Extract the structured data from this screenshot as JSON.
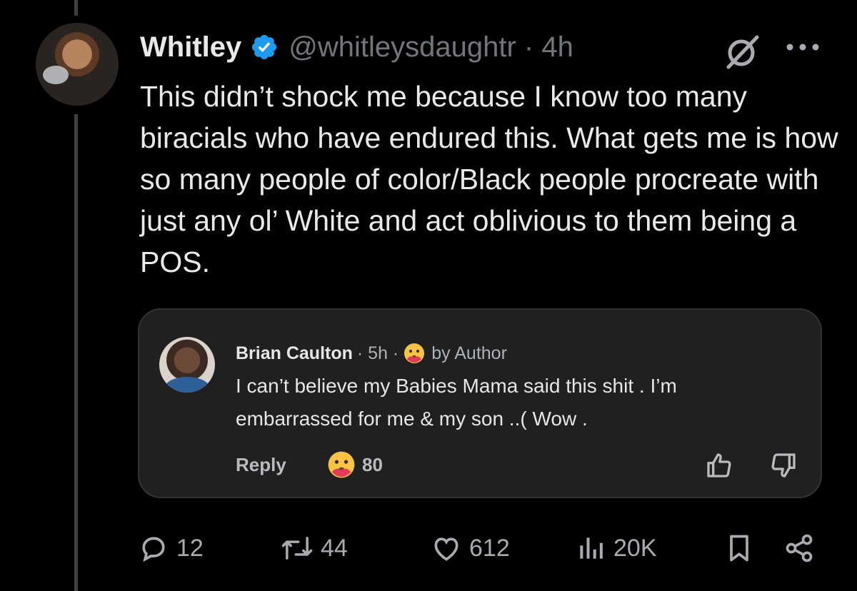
{
  "tweet": {
    "display_name": "Whitley",
    "handle": "@whitleysdaughtr · 4h",
    "text": "This didn’t shock me because I know too many biracials who have endured this. What gets me is how so many people of color/Black people procreate with just any ol’ White and act oblivious to them being a POS.",
    "icons": {
      "verified": "verified-badge-icon",
      "grok": "grok-icon",
      "more": "more-dots-icon"
    },
    "accent_color": "#1d9bf0"
  },
  "quote": {
    "name": "Brian Caulton",
    "time": "· 5h ·",
    "author_tag": "by Author",
    "text": "I can’t believe my Babies Mama said this shit . I’m embarrassed for me & my son  ..( Wow .",
    "reply_label": "Reply",
    "reaction_count": "80",
    "icons": {
      "reaction": "hug-face-emoji-icon",
      "like": "thumbs-up-icon",
      "dislike": "thumbs-down-icon"
    }
  },
  "actions": {
    "replies": "12",
    "retweets": "44",
    "likes": "612",
    "views": "20K",
    "icons": [
      "reply-icon",
      "retweet-icon",
      "like-icon",
      "views-icon",
      "bookmark-icon",
      "share-icon"
    ]
  }
}
